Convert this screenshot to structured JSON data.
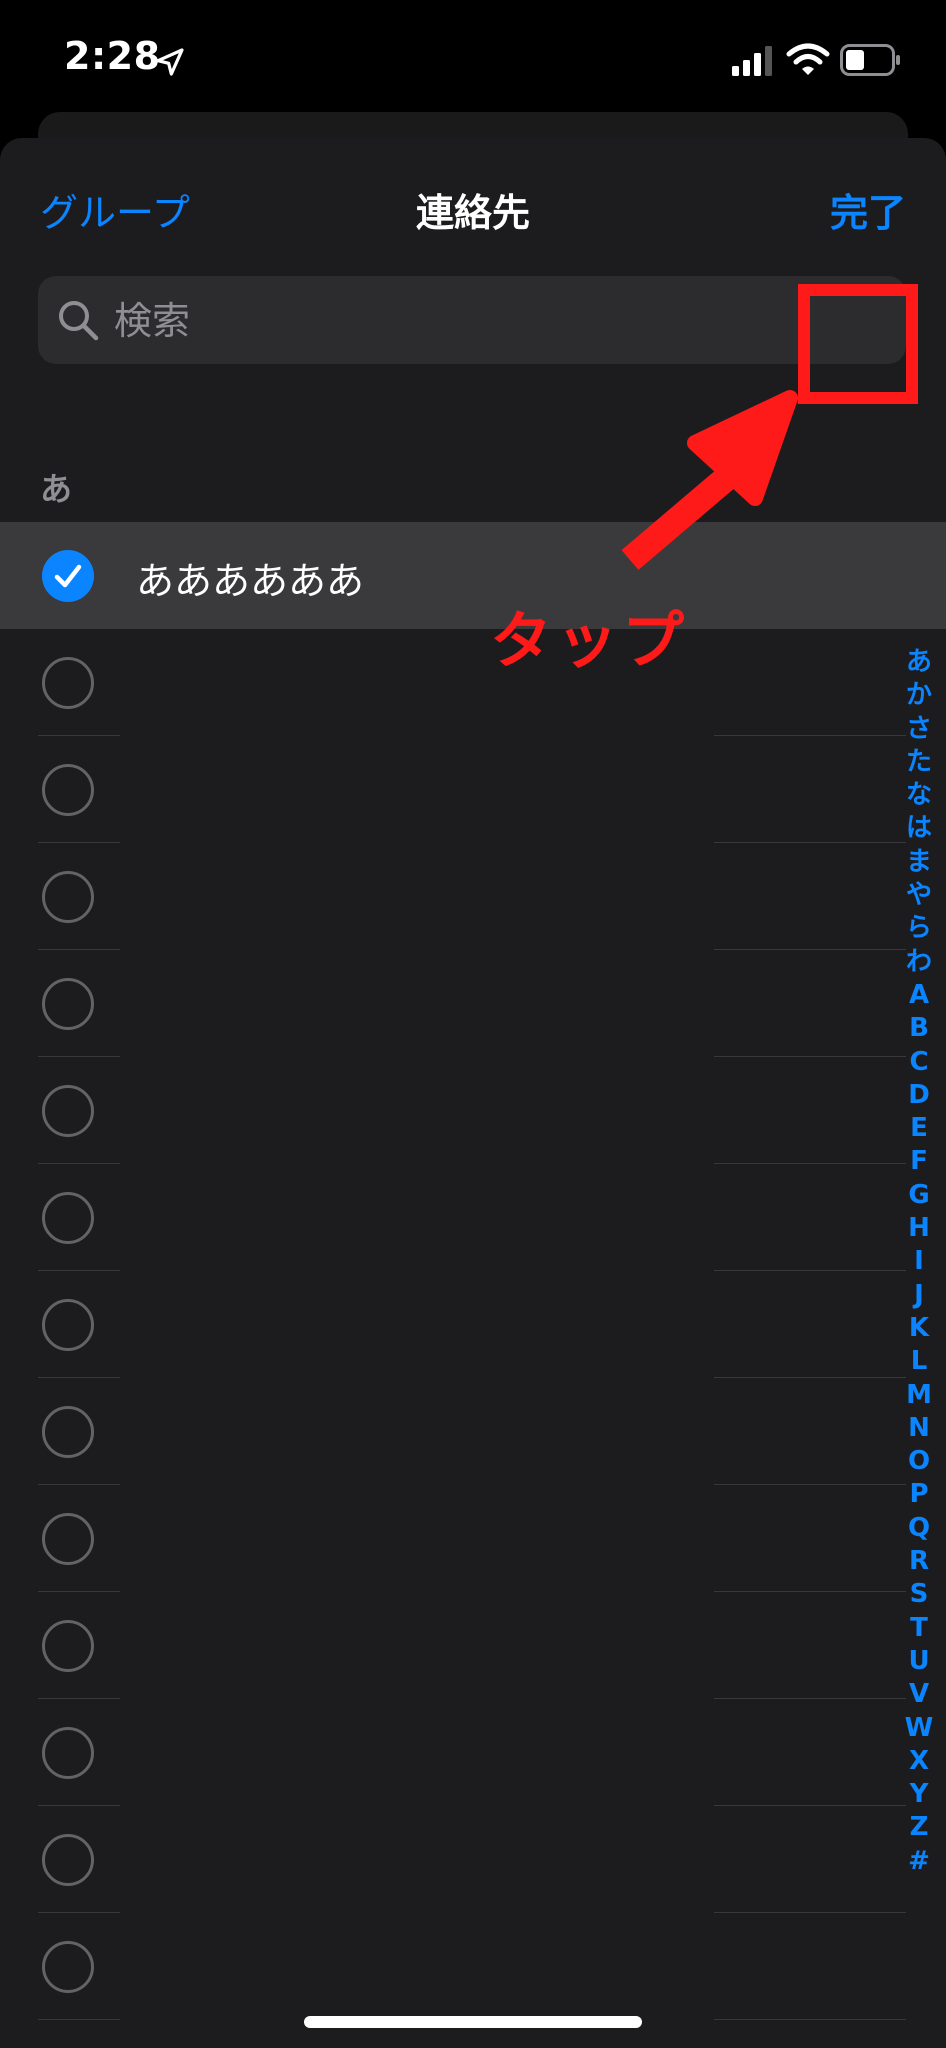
{
  "status_bar": {
    "time": "2:28"
  },
  "nav": {
    "left": "グループ",
    "title": "連絡先",
    "right": "完了"
  },
  "search": {
    "placeholder": "検索",
    "value": ""
  },
  "section_header": "あ",
  "contacts": [
    {
      "name": "ああああああ",
      "selected": true
    },
    {
      "name": "",
      "selected": false
    },
    {
      "name": "",
      "selected": false
    },
    {
      "name": "",
      "selected": false
    },
    {
      "name": "",
      "selected": false
    },
    {
      "name": "",
      "selected": false
    },
    {
      "name": "",
      "selected": false
    },
    {
      "name": "",
      "selected": false
    },
    {
      "name": "",
      "selected": false
    },
    {
      "name": "",
      "selected": false
    },
    {
      "name": "",
      "selected": false
    },
    {
      "name": "",
      "selected": false
    },
    {
      "name": "",
      "selected": false
    },
    {
      "name": "",
      "selected": false
    }
  ],
  "index_letters": [
    "あ",
    "か",
    "さ",
    "た",
    "な",
    "は",
    "ま",
    "や",
    "ら",
    "わ",
    "A",
    "B",
    "C",
    "D",
    "E",
    "F",
    "G",
    "H",
    "I",
    "J",
    "K",
    "L",
    "M",
    "N",
    "O",
    "P",
    "Q",
    "R",
    "S",
    "T",
    "U",
    "V",
    "W",
    "X",
    "Y",
    "Z",
    "#"
  ],
  "annotation": {
    "label": "タップ",
    "color": "#ff1a1a"
  },
  "colors": {
    "accent": "#0a84ff",
    "sheet": "#1c1c1e",
    "selected_row": "#3a3a3c"
  }
}
